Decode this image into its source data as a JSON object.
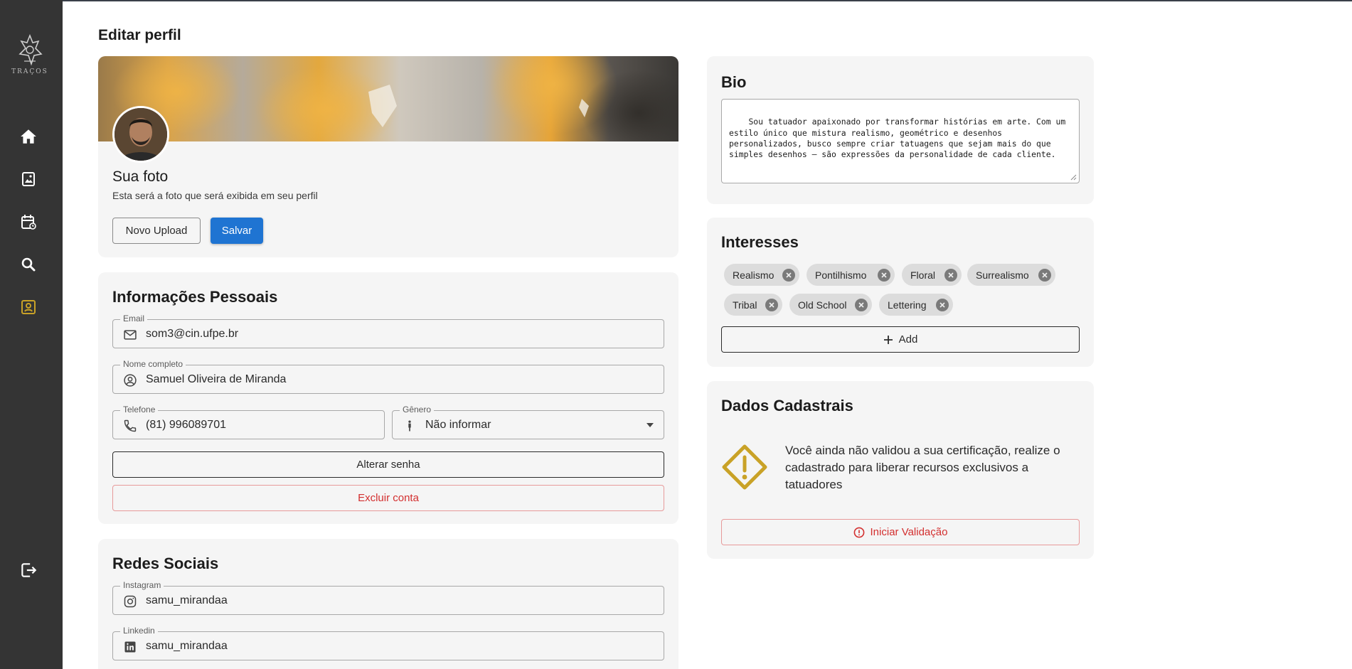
{
  "page": {
    "title": "Editar perfil"
  },
  "sidebar": {
    "logo_text": "TRAÇOS",
    "items": [
      {
        "icon": "home-icon"
      },
      {
        "icon": "gallery-icon"
      },
      {
        "icon": "calendar-icon"
      },
      {
        "icon": "search-icon"
      },
      {
        "icon": "profile-icon",
        "active": true
      }
    ],
    "logout_icon": "logout-icon"
  },
  "photo": {
    "title": "Sua foto",
    "subtitle": "Esta será a foto que será exibida em seu perfil",
    "upload_label": "Novo Upload",
    "save_label": "Salvar"
  },
  "personal": {
    "title": "Informações Pessoais",
    "email_label": "Email",
    "email_value": "som3@cin.ufpe.br",
    "name_label": "Nome completo",
    "name_value": "Samuel Oliveira de Miranda",
    "phone_label": "Telefone",
    "phone_value": "(81) 996089701",
    "gender_label": "Gênero",
    "gender_value": "Não informar",
    "change_password_label": "Alterar senha",
    "delete_account_label": "Excluir conta"
  },
  "social": {
    "title": "Redes Sociais",
    "instagram_label": "Instagram",
    "instagram_value": "samu_mirandaa",
    "linkedin_label": "Linkedin",
    "linkedin_value": "samu_mirandaa"
  },
  "bio": {
    "title": "Bio",
    "text": "Sou tatuador apaixonado por transformar histórias em arte. Com um estilo único que mistura realismo, geométrico e desenhos personalizados, busco sempre criar tatuagens que sejam mais do que simples desenhos – são expressões da personalidade de cada cliente."
  },
  "interests": {
    "title": "Interesses",
    "tags": [
      "Realismo",
      "Pontilhismo",
      "Floral",
      "Surrealismo",
      "Tribal",
      "Old School",
      "Lettering"
    ],
    "add_label": "Add"
  },
  "registration": {
    "title": "Dados Cadastrais",
    "message": "Você ainda não validou a sua certificação, realize o cadastrado para liberar recursos exclusivos a tatuadores",
    "validate_label": "Iniciar Validação"
  },
  "colors": {
    "sidebar": "#343434",
    "accent_gold": "#c9a227",
    "primary": "#1f74d2",
    "danger": "#d32f2f"
  }
}
